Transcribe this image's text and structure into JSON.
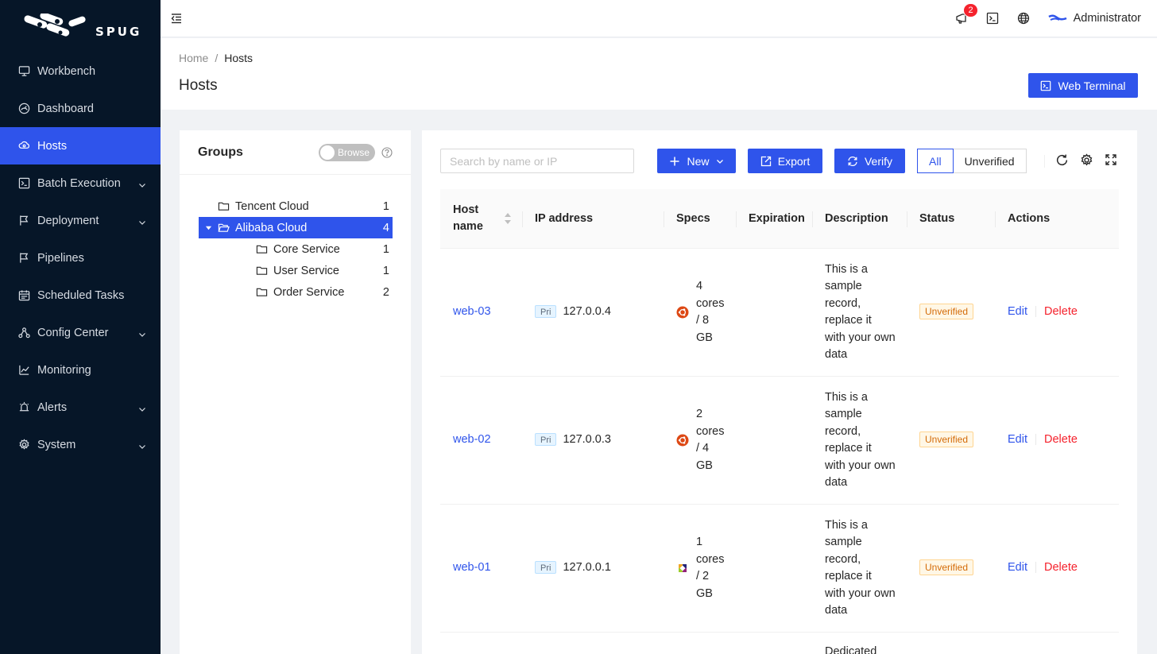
{
  "brand": {
    "logo_text": "SPUG"
  },
  "sidebar": {
    "items": [
      {
        "label": "Workbench",
        "icon": "monitor-icon",
        "has_children": false,
        "active": false
      },
      {
        "label": "Dashboard",
        "icon": "dashboard-icon",
        "has_children": false,
        "active": false
      },
      {
        "label": "Hosts",
        "icon": "cloud-server-icon",
        "has_children": false,
        "active": true
      },
      {
        "label": "Batch Execution",
        "icon": "code-icon",
        "has_children": true,
        "active": false
      },
      {
        "label": "Deployment",
        "icon": "flag-icon",
        "has_children": true,
        "active": false
      },
      {
        "label": "Pipelines",
        "icon": "flag-icon",
        "has_children": false,
        "active": false
      },
      {
        "label": "Scheduled Tasks",
        "icon": "schedule-icon",
        "has_children": false,
        "active": false
      },
      {
        "label": "Config Center",
        "icon": "deployment-unit-icon",
        "has_children": true,
        "active": false
      },
      {
        "label": "Monitoring",
        "icon": "radar-icon",
        "has_children": false,
        "active": false
      },
      {
        "label": "Alerts",
        "icon": "alert-icon",
        "has_children": true,
        "active": false
      },
      {
        "label": "System",
        "icon": "setting-icon",
        "has_children": true,
        "active": false
      }
    ]
  },
  "header": {
    "notification_count": "2",
    "user_name": "Administrator"
  },
  "page": {
    "breadcrumb_home": "Home",
    "breadcrumb_sep": "/",
    "breadcrumb_current": "Hosts",
    "title": "Hosts",
    "web_terminal_label": "Web Terminal"
  },
  "groups": {
    "title": "Groups",
    "toggle_label": "Browse",
    "tree": [
      {
        "label": "Tencent Cloud",
        "count": "1",
        "level": 0,
        "expanded": false,
        "selected": false,
        "has_children": false
      },
      {
        "label": "Alibaba Cloud",
        "count": "4",
        "level": 0,
        "expanded": true,
        "selected": true,
        "has_children": true
      },
      {
        "label": "Core Service",
        "count": "1",
        "level": 1,
        "expanded": false,
        "selected": false,
        "has_children": false
      },
      {
        "label": "User Service",
        "count": "1",
        "level": 1,
        "expanded": false,
        "selected": false,
        "has_children": false
      },
      {
        "label": "Order Service",
        "count": "2",
        "level": 1,
        "expanded": false,
        "selected": false,
        "has_children": false
      }
    ]
  },
  "toolbar": {
    "search_placeholder": "Search by name or IP",
    "new_label": "New",
    "export_label": "Export",
    "verify_label": "Verify",
    "filter_all": "All",
    "filter_unverified": "Unverified"
  },
  "table": {
    "headers": {
      "host_name_line1": "Host",
      "host_name_line2": "name",
      "ip": "IP address",
      "specs": "Specs",
      "expiration": "Expiration",
      "description": "Description",
      "status": "Status",
      "actions": "Actions"
    },
    "rows": [
      {
        "name": "web-03",
        "ip_tag": "Pri",
        "ip": "127.0.0.4",
        "os": "ubuntu",
        "spec_lines": [
          "4",
          "cores",
          "/ 8",
          "GB"
        ],
        "expiration": "",
        "desc_lines": [
          "This is a",
          "sample",
          "record,",
          "replace it",
          "with your own",
          "data"
        ],
        "status": "Unverified",
        "edit": "Edit",
        "delete": "Delete"
      },
      {
        "name": "web-02",
        "ip_tag": "Pri",
        "ip": "127.0.0.3",
        "os": "ubuntu",
        "spec_lines": [
          "2",
          "cores",
          "/ 4",
          "GB"
        ],
        "expiration": "",
        "desc_lines": [
          "This is a",
          "sample",
          "record,",
          "replace it",
          "with your own",
          "data"
        ],
        "status": "Unverified",
        "edit": "Edit",
        "delete": "Delete"
      },
      {
        "name": "web-01",
        "ip_tag": "Pri",
        "ip": "127.0.0.1",
        "os": "centos",
        "spec_lines": [
          "1",
          "cores",
          "/ 2",
          "GB"
        ],
        "expiration": "",
        "desc_lines": [
          "This is a",
          "sample",
          "record,",
          "replace it",
          "with your own",
          "data"
        ],
        "status": "Unverified",
        "edit": "Edit",
        "delete": "Delete"
      }
    ],
    "partial_next_row_desc": "Dedicated"
  },
  "colors": {
    "primary": "#2f54eb",
    "sidebar_bg": "#061628",
    "danger": "#f5222d",
    "warning_text": "#d46b08"
  }
}
